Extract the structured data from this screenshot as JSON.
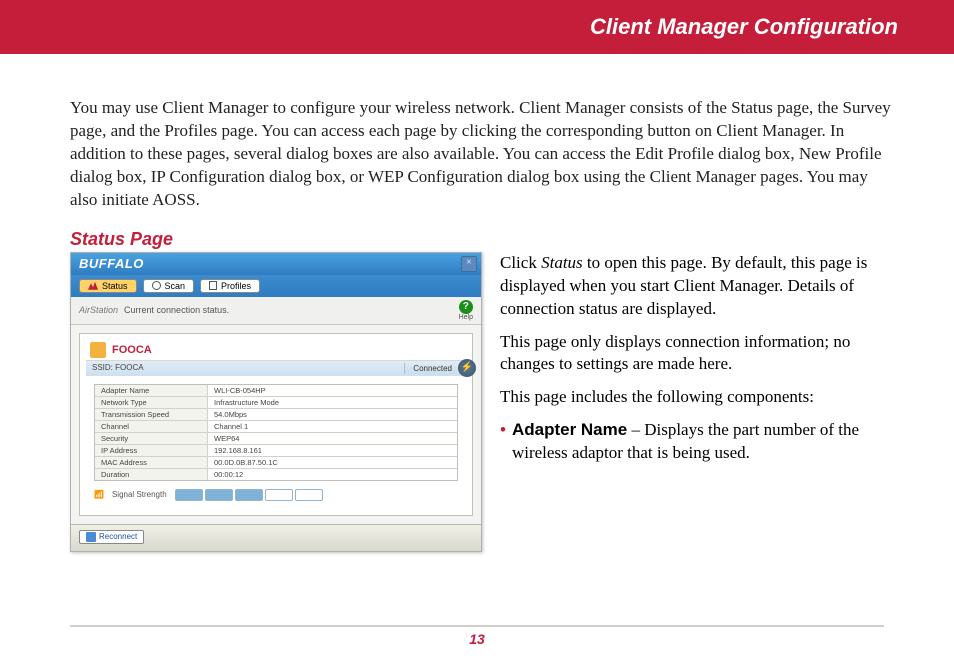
{
  "header": {
    "title": "Client Manager Configuration"
  },
  "intro": "You may use Client Manager to configure your wireless network. Client Manager consists of the Status page, the Survey page, and the Profiles page. You can access each page by clicking the corresponding button on Client Manager. In addition to these pages, several dialog boxes are also available. You can access the Edit Profile dialog box, New Profile dialog box, IP Configuration dialog box, or WEP Configuration dialog box using the Client Manager pages.  You may also initiate AOSS.",
  "section_heading": "Status Page",
  "right": {
    "p1": "Click Status to open this page. By default, this page is displayed when you start Client Manager. Details of connection status are displayed.",
    "p2": "This page only displays connection information; no changes to settings are made here.",
    "p3": "This page includes the following components:",
    "bullet_label": "Adapter Name",
    "bullet_text": " – Displays the part number of the wireless adaptor that is being used."
  },
  "app": {
    "brand": "BUFFALO",
    "tabs": {
      "status": "Status",
      "scan": "Scan",
      "profiles": "Profiles"
    },
    "air": "AirStation",
    "cc_status": "Current connection status.",
    "help": "Help",
    "ssid_name": "FOOCA",
    "ssid_label": "SSID: FOOCA",
    "connected": "Connected",
    "rows": [
      {
        "label": "Adapter Name",
        "value": "WLI-CB-054HP"
      },
      {
        "label": "Network Type",
        "value": "Infrastructure Mode"
      },
      {
        "label": "Transmission Speed",
        "value": "54.0Mbps"
      },
      {
        "label": "Channel",
        "value": "Channel 1"
      },
      {
        "label": "Security",
        "value": "WEP64"
      },
      {
        "label": "IP Address",
        "value": "192.168.8.161"
      },
      {
        "label": "MAC Address",
        "value": "00.0D.0B.87.50.1C"
      },
      {
        "label": "Duration",
        "value": "00:00:12"
      }
    ],
    "signal_label": "Signal Strength",
    "reconnect": "Reconnect"
  },
  "page_number": "13"
}
